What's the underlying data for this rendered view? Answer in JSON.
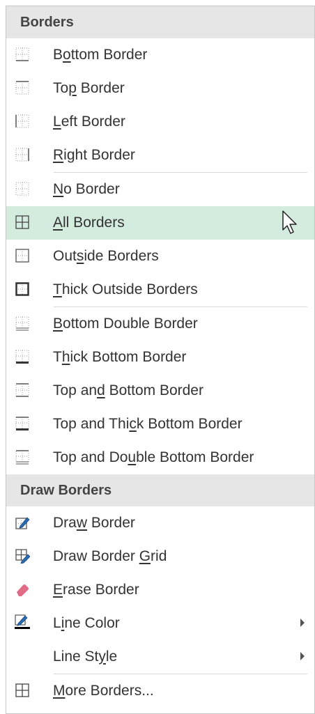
{
  "menu": {
    "section_borders": "Borders",
    "section_draw": "Draw Borders",
    "items": [
      {
        "pre": "B",
        "u": "o",
        "post": "ttom Border",
        "icon": "bottom-border-icon"
      },
      {
        "pre": "To",
        "u": "p",
        "post": " Border",
        "icon": "top-border-icon"
      },
      {
        "pre": "",
        "u": "L",
        "post": "eft Border",
        "icon": "left-border-icon"
      },
      {
        "pre": "",
        "u": "R",
        "post": "ight Border",
        "icon": "right-border-icon"
      },
      {
        "pre": "",
        "u": "N",
        "post": "o Border",
        "icon": "no-border-icon"
      },
      {
        "pre": "",
        "u": "A",
        "post": "ll Borders",
        "icon": "all-borders-icon",
        "highlighted": true
      },
      {
        "pre": "Out",
        "u": "s",
        "post": "ide Borders",
        "icon": "outside-borders-icon"
      },
      {
        "pre": "",
        "u": "T",
        "post": "hick Outside Borders",
        "icon": "thick-outside-borders-icon"
      },
      {
        "pre": "",
        "u": "B",
        "post": "ottom Double Border",
        "icon": "bottom-double-border-icon"
      },
      {
        "pre": "T",
        "u": "h",
        "post": "ick Bottom Border",
        "icon": "thick-bottom-border-icon"
      },
      {
        "pre": "Top an",
        "u": "d",
        "post": " Bottom Border",
        "icon": "top-and-bottom-border-icon"
      },
      {
        "pre": "Top and Thi",
        "u": "c",
        "post": "k Bottom Border",
        "icon": "top-and-thick-bottom-border-icon"
      },
      {
        "pre": "Top and Do",
        "u": "u",
        "post": "ble Bottom Border",
        "icon": "top-and-double-bottom-border-icon"
      },
      {
        "pre": "Dra",
        "u": "w",
        "post": " Border",
        "icon": "draw-border-icon"
      },
      {
        "pre": "Draw Border ",
        "u": "G",
        "post": "rid",
        "icon": "draw-border-grid-icon"
      },
      {
        "pre": "",
        "u": "E",
        "post": "rase Border",
        "icon": "eraser-icon"
      },
      {
        "pre": "L",
        "u": "i",
        "post": "ne Color",
        "icon": "line-color-icon",
        "submenu": true
      },
      {
        "pre": "Line St",
        "u": "y",
        "post": "le",
        "icon": "",
        "submenu": true
      },
      {
        "pre": "",
        "u": "M",
        "post": "ore Borders...",
        "icon": "more-borders-icon"
      }
    ]
  },
  "colors": {
    "highlight": "#d4ecdd",
    "header_bg": "#e6e6e6",
    "pencil": "#2b6cb0",
    "eraser": "#e06c85",
    "line_color_bar": "#000000"
  }
}
